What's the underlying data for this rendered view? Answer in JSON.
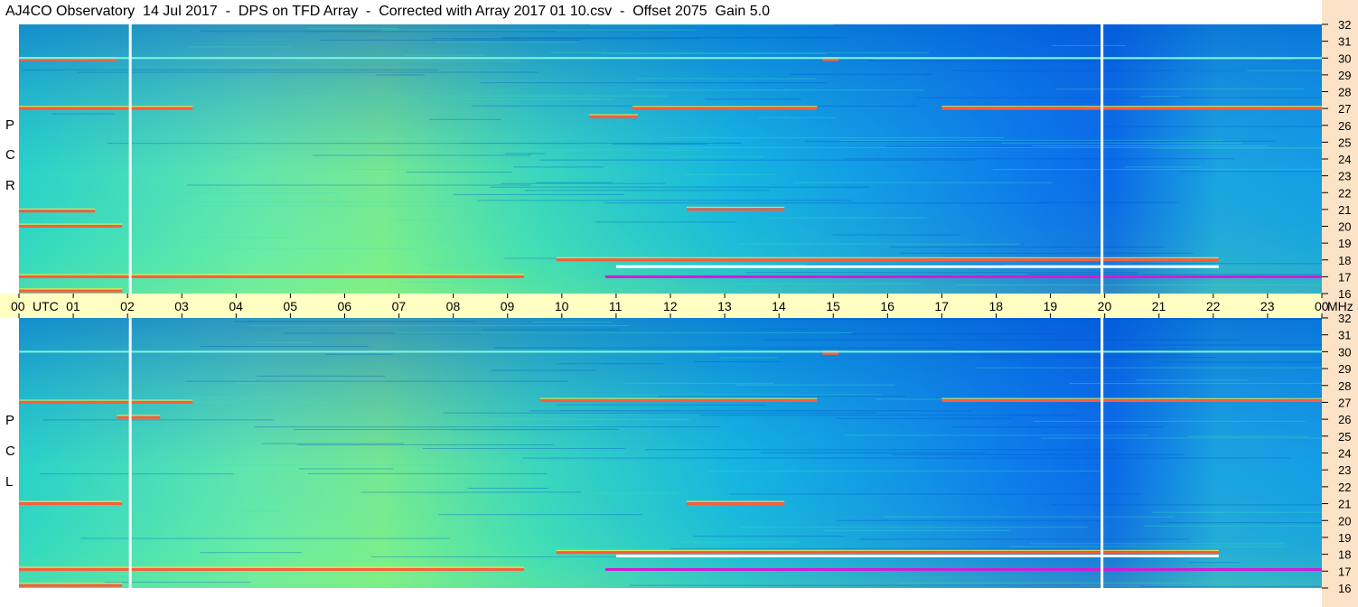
{
  "title": "AJ4CO Observatory  14 Jul 2017  -  DPS on TFD Array  -  Corrected with Array 2017 01 10.csv  -  Offset 2075  Gain 5.0",
  "colors": {
    "time_band": "#ffffc4",
    "right_strip": "#fce3c8",
    "panel_cold": "#0a6fe8",
    "panel_mid": "#16c8d8",
    "panel_warm": "#8ef07a",
    "rfi_hot": "#ff5a3c",
    "rfi_mag": "#d41ad4"
  },
  "chart_data": [
    {
      "type": "heatmap",
      "panel": "RCP",
      "ylabel_letters": [
        "R",
        "C",
        "P"
      ],
      "y_unit": "MHz",
      "ylim": [
        16,
        32
      ],
      "y_ticks": [
        "16",
        "17",
        "18",
        "19",
        "20",
        "21",
        "22",
        "23",
        "24",
        "25",
        "26",
        "27",
        "28",
        "29",
        "30",
        "31",
        "32"
      ],
      "x_ticks": [
        "00",
        "01",
        "02",
        "03",
        "04",
        "05",
        "06",
        "07",
        "08",
        "09",
        "10",
        "11",
        "12",
        "13",
        "14",
        "15",
        "16",
        "17",
        "18",
        "19",
        "20",
        "21",
        "22",
        "23",
        "00"
      ],
      "xlim_hours": [
        0,
        24
      ],
      "x_unit": "UTC",
      "markers_hours": [
        2.05,
        19.95
      ],
      "rfi_bands_mhz": [
        {
          "f": 16.15,
          "t0": 0.0,
          "t1": 1.9,
          "color": "hot"
        },
        {
          "f": 17.0,
          "t0": 0.0,
          "t1": 9.3,
          "color": "hot"
        },
        {
          "f": 17.0,
          "t0": 10.8,
          "t1": 24.0,
          "color": "mag"
        },
        {
          "f": 17.6,
          "t0": 11.0,
          "t1": 22.1,
          "color": "white"
        },
        {
          "f": 18.0,
          "t0": 9.9,
          "t1": 22.1,
          "color": "hot"
        },
        {
          "f": 20.0,
          "t0": 0.0,
          "t1": 1.9,
          "color": "hot"
        },
        {
          "f": 20.9,
          "t0": 0.0,
          "t1": 1.4,
          "color": "hot"
        },
        {
          "f": 21.0,
          "t0": 12.3,
          "t1": 14.1,
          "color": "hot"
        },
        {
          "f": 26.5,
          "t0": 10.5,
          "t1": 11.4,
          "color": "hot"
        },
        {
          "f": 27.0,
          "t0": 0.0,
          "t1": 3.2,
          "color": "hot"
        },
        {
          "f": 27.0,
          "t0": 11.3,
          "t1": 14.7,
          "color": "hot"
        },
        {
          "f": 27.0,
          "t0": 17.0,
          "t1": 24.0,
          "color": "hot"
        },
        {
          "f": 29.9,
          "t0": 0.0,
          "t1": 1.8,
          "color": "hot"
        },
        {
          "f": 29.9,
          "t0": 14.8,
          "t1": 15.1,
          "color": "hot"
        }
      ]
    },
    {
      "type": "heatmap",
      "panel": "LCP",
      "ylabel_letters": [
        "L",
        "C",
        "P"
      ],
      "y_unit": "MHz",
      "ylim": [
        16,
        32
      ],
      "y_ticks": [
        "16",
        "17",
        "18",
        "19",
        "20",
        "21",
        "22",
        "23",
        "24",
        "25",
        "26",
        "27",
        "28",
        "29",
        "30",
        "31",
        "32"
      ],
      "x_ticks": [
        "00",
        "01",
        "02",
        "03",
        "04",
        "05",
        "06",
        "07",
        "08",
        "09",
        "10",
        "11",
        "12",
        "13",
        "14",
        "15",
        "16",
        "17",
        "18",
        "19",
        "20",
        "21",
        "22",
        "23",
        "00"
      ],
      "xlim_hours": [
        0,
        24
      ],
      "x_unit": "UTC",
      "markers_hours": [
        2.05,
        19.95
      ],
      "rfi_bands_mhz": [
        {
          "f": 16.15,
          "t0": 0.0,
          "t1": 1.9,
          "color": "hot"
        },
        {
          "f": 17.1,
          "t0": 0.0,
          "t1": 9.3,
          "color": "hot"
        },
        {
          "f": 17.1,
          "t0": 10.8,
          "t1": 24.0,
          "color": "mag"
        },
        {
          "f": 17.9,
          "t0": 11.0,
          "t1": 22.1,
          "color": "white"
        },
        {
          "f": 18.1,
          "t0": 9.9,
          "t1": 22.1,
          "color": "hot"
        },
        {
          "f": 21.0,
          "t0": 0.0,
          "t1": 1.9,
          "color": "hot"
        },
        {
          "f": 21.0,
          "t0": 12.3,
          "t1": 14.1,
          "color": "hot"
        },
        {
          "f": 26.1,
          "t0": 1.8,
          "t1": 2.6,
          "color": "hot"
        },
        {
          "f": 27.0,
          "t0": 0.0,
          "t1": 3.2,
          "color": "hot"
        },
        {
          "f": 27.1,
          "t0": 9.6,
          "t1": 14.7,
          "color": "hot"
        },
        {
          "f": 27.1,
          "t0": 17.0,
          "t1": 24.0,
          "color": "hot"
        },
        {
          "f": 29.9,
          "t0": 14.8,
          "t1": 15.1,
          "color": "hot"
        }
      ]
    }
  ],
  "time_axis": {
    "utc_label": "UTC",
    "mhz_label": "MHz"
  }
}
